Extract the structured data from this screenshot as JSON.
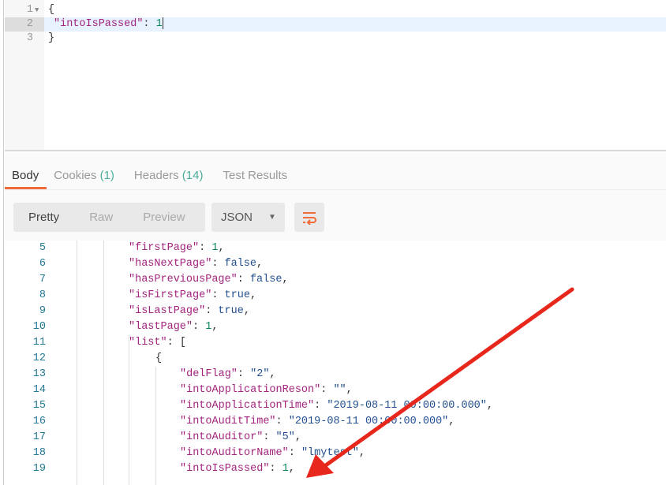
{
  "request_body": {
    "lines": [
      {
        "num": "1",
        "text": "{"
      },
      {
        "num": "2",
        "key": "\"intoIsPassed\"",
        "sep": ": ",
        "value": "1"
      },
      {
        "num": "3",
        "text": "}"
      }
    ]
  },
  "response": {
    "tabs": [
      {
        "label": "Body"
      },
      {
        "label": "Cookies",
        "count": "(1)"
      },
      {
        "label": "Headers",
        "count": "(14)"
      },
      {
        "label": "Test Results"
      }
    ],
    "view_modes": [
      "Pretty",
      "Raw",
      "Preview"
    ],
    "format": "JSON",
    "wrap_icon": "wrap-lines-icon",
    "lines": [
      {
        "num": "5",
        "key": "\"firstPage\"",
        "value": "1",
        "type": "num",
        "tail": ","
      },
      {
        "num": "6",
        "key": "\"hasNextPage\"",
        "value": "false",
        "type": "b",
        "tail": ","
      },
      {
        "num": "7",
        "key": "\"hasPreviousPage\"",
        "value": "false",
        "type": "b",
        "tail": ","
      },
      {
        "num": "8",
        "key": "\"isFirstPage\"",
        "value": "true",
        "type": "b",
        "tail": ","
      },
      {
        "num": "9",
        "key": "\"isLastPage\"",
        "value": "true",
        "type": "b",
        "tail": ","
      },
      {
        "num": "10",
        "key": "\"lastPage\"",
        "value": "1",
        "type": "num",
        "tail": ","
      },
      {
        "num": "11",
        "key": "\"list\"",
        "value": "[",
        "type": "p",
        "tail": ""
      },
      {
        "num": "12",
        "text": "{"
      },
      {
        "num": "13",
        "key": "\"delFlag\"",
        "value": "\"2\"",
        "type": "s",
        "tail": ","
      },
      {
        "num": "14",
        "key": "\"intoApplicationReson\"",
        "value": "\"\"",
        "type": "s",
        "tail": ","
      },
      {
        "num": "15",
        "key": "\"intoApplicationTime\"",
        "value": "\"2019-08-11 00:00:00.000\"",
        "type": "s",
        "tail": ","
      },
      {
        "num": "16",
        "key": "\"intoAuditTime\"",
        "value": "\"2019-08-11 00:00:00.000\"",
        "type": "s",
        "tail": ","
      },
      {
        "num": "17",
        "key": "\"intoAuditor\"",
        "value": "\"5\"",
        "type": "s",
        "tail": ","
      },
      {
        "num": "18",
        "key": "\"intoAuditorName\"",
        "value": "\"lmytest\"",
        "type": "s",
        "tail": ","
      },
      {
        "num": "19",
        "key": "\"intoIsPassed\"",
        "value": "1",
        "type": "num",
        "tail": ","
      }
    ]
  },
  "colors": {
    "accent": "#f26b3a",
    "count": "#4aae9b",
    "arrow": "#e8271c"
  }
}
